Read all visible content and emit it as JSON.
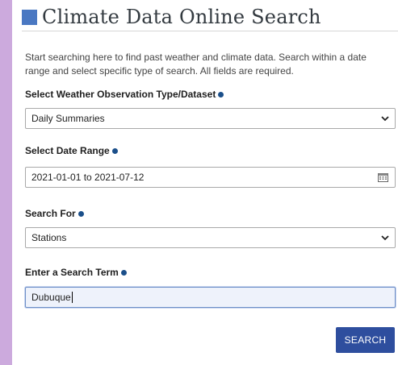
{
  "page": {
    "title": "Climate Data Online Search",
    "intro": "Start searching here to find past weather and climate data. Search within a date range and select specific type of search. All fields are required."
  },
  "dataset": {
    "label": "Select Weather Observation Type/Dataset",
    "value": "Daily Summaries"
  },
  "date_range": {
    "label": "Select Date Range",
    "value": "2021-01-01 to 2021-07-12"
  },
  "search_for": {
    "label": "Search For",
    "value": "Stations"
  },
  "search_term": {
    "label": "Enter a Search Term",
    "value": "Dubuque"
  },
  "search_button": {
    "label": "SEARCH"
  },
  "colors": {
    "accent": "#4a78c2",
    "button": "#2e4e9e",
    "sidebar": "#ccaadd"
  }
}
